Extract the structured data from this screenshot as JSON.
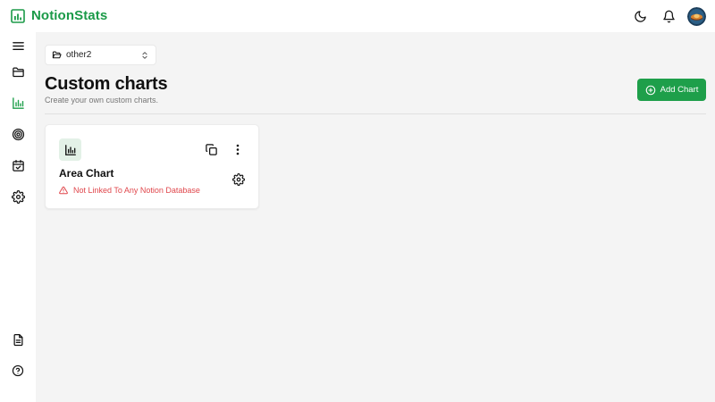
{
  "app": {
    "name": "NotionStats"
  },
  "header": {
    "icons": [
      "chart-logo-icon",
      "moon-icon",
      "bell-icon",
      "avatar"
    ]
  },
  "sidebar": {
    "items": [
      {
        "icon": "menu-icon"
      },
      {
        "icon": "folder-icon"
      },
      {
        "icon": "bar-chart-icon",
        "active": true
      },
      {
        "icon": "target-icon"
      },
      {
        "icon": "calendar-check-icon"
      },
      {
        "icon": "gear-icon"
      },
      {
        "icon": "document-icon"
      },
      {
        "icon": "help-icon"
      }
    ]
  },
  "workspace": {
    "selected": "other2"
  },
  "page": {
    "title": "Custom charts",
    "subtitle": "Create your own custom charts.",
    "add_button_label": "Add Chart"
  },
  "cards": [
    {
      "title": "Area Chart",
      "warning": "Not Linked To Any Notion Database",
      "icon": "bar-chart-icon"
    }
  ],
  "colors": {
    "brand": "#1b9a48",
    "primary_button": "#1e9f4a",
    "warning": "#e0474c",
    "background": "#f4f4f4"
  }
}
